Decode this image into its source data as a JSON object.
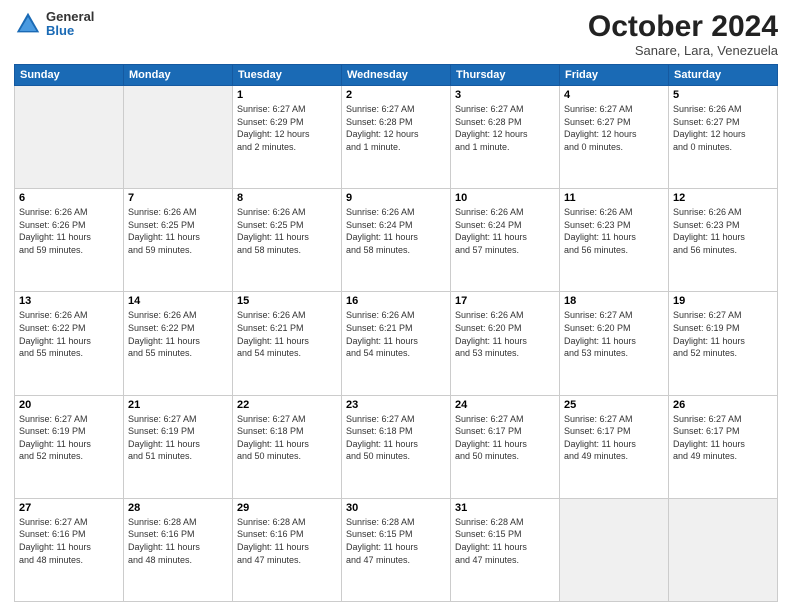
{
  "header": {
    "logo_line1": "General",
    "logo_line2": "Blue",
    "month": "October 2024",
    "location": "Sanare, Lara, Venezuela"
  },
  "weekdays": [
    "Sunday",
    "Monday",
    "Tuesday",
    "Wednesday",
    "Thursday",
    "Friday",
    "Saturday"
  ],
  "weeks": [
    [
      {
        "day": "",
        "info": ""
      },
      {
        "day": "",
        "info": ""
      },
      {
        "day": "1",
        "info": "Sunrise: 6:27 AM\nSunset: 6:29 PM\nDaylight: 12 hours\nand 2 minutes."
      },
      {
        "day": "2",
        "info": "Sunrise: 6:27 AM\nSunset: 6:28 PM\nDaylight: 12 hours\nand 1 minute."
      },
      {
        "day": "3",
        "info": "Sunrise: 6:27 AM\nSunset: 6:28 PM\nDaylight: 12 hours\nand 1 minute."
      },
      {
        "day": "4",
        "info": "Sunrise: 6:27 AM\nSunset: 6:27 PM\nDaylight: 12 hours\nand 0 minutes."
      },
      {
        "day": "5",
        "info": "Sunrise: 6:26 AM\nSunset: 6:27 PM\nDaylight: 12 hours\nand 0 minutes."
      }
    ],
    [
      {
        "day": "6",
        "info": "Sunrise: 6:26 AM\nSunset: 6:26 PM\nDaylight: 11 hours\nand 59 minutes."
      },
      {
        "day": "7",
        "info": "Sunrise: 6:26 AM\nSunset: 6:25 PM\nDaylight: 11 hours\nand 59 minutes."
      },
      {
        "day": "8",
        "info": "Sunrise: 6:26 AM\nSunset: 6:25 PM\nDaylight: 11 hours\nand 58 minutes."
      },
      {
        "day": "9",
        "info": "Sunrise: 6:26 AM\nSunset: 6:24 PM\nDaylight: 11 hours\nand 58 minutes."
      },
      {
        "day": "10",
        "info": "Sunrise: 6:26 AM\nSunset: 6:24 PM\nDaylight: 11 hours\nand 57 minutes."
      },
      {
        "day": "11",
        "info": "Sunrise: 6:26 AM\nSunset: 6:23 PM\nDaylight: 11 hours\nand 56 minutes."
      },
      {
        "day": "12",
        "info": "Sunrise: 6:26 AM\nSunset: 6:23 PM\nDaylight: 11 hours\nand 56 minutes."
      }
    ],
    [
      {
        "day": "13",
        "info": "Sunrise: 6:26 AM\nSunset: 6:22 PM\nDaylight: 11 hours\nand 55 minutes."
      },
      {
        "day": "14",
        "info": "Sunrise: 6:26 AM\nSunset: 6:22 PM\nDaylight: 11 hours\nand 55 minutes."
      },
      {
        "day": "15",
        "info": "Sunrise: 6:26 AM\nSunset: 6:21 PM\nDaylight: 11 hours\nand 54 minutes."
      },
      {
        "day": "16",
        "info": "Sunrise: 6:26 AM\nSunset: 6:21 PM\nDaylight: 11 hours\nand 54 minutes."
      },
      {
        "day": "17",
        "info": "Sunrise: 6:26 AM\nSunset: 6:20 PM\nDaylight: 11 hours\nand 53 minutes."
      },
      {
        "day": "18",
        "info": "Sunrise: 6:27 AM\nSunset: 6:20 PM\nDaylight: 11 hours\nand 53 minutes."
      },
      {
        "day": "19",
        "info": "Sunrise: 6:27 AM\nSunset: 6:19 PM\nDaylight: 11 hours\nand 52 minutes."
      }
    ],
    [
      {
        "day": "20",
        "info": "Sunrise: 6:27 AM\nSunset: 6:19 PM\nDaylight: 11 hours\nand 52 minutes."
      },
      {
        "day": "21",
        "info": "Sunrise: 6:27 AM\nSunset: 6:19 PM\nDaylight: 11 hours\nand 51 minutes."
      },
      {
        "day": "22",
        "info": "Sunrise: 6:27 AM\nSunset: 6:18 PM\nDaylight: 11 hours\nand 50 minutes."
      },
      {
        "day": "23",
        "info": "Sunrise: 6:27 AM\nSunset: 6:18 PM\nDaylight: 11 hours\nand 50 minutes."
      },
      {
        "day": "24",
        "info": "Sunrise: 6:27 AM\nSunset: 6:17 PM\nDaylight: 11 hours\nand 50 minutes."
      },
      {
        "day": "25",
        "info": "Sunrise: 6:27 AM\nSunset: 6:17 PM\nDaylight: 11 hours\nand 49 minutes."
      },
      {
        "day": "26",
        "info": "Sunrise: 6:27 AM\nSunset: 6:17 PM\nDaylight: 11 hours\nand 49 minutes."
      }
    ],
    [
      {
        "day": "27",
        "info": "Sunrise: 6:27 AM\nSunset: 6:16 PM\nDaylight: 11 hours\nand 48 minutes."
      },
      {
        "day": "28",
        "info": "Sunrise: 6:28 AM\nSunset: 6:16 PM\nDaylight: 11 hours\nand 48 minutes."
      },
      {
        "day": "29",
        "info": "Sunrise: 6:28 AM\nSunset: 6:16 PM\nDaylight: 11 hours\nand 47 minutes."
      },
      {
        "day": "30",
        "info": "Sunrise: 6:28 AM\nSunset: 6:15 PM\nDaylight: 11 hours\nand 47 minutes."
      },
      {
        "day": "31",
        "info": "Sunrise: 6:28 AM\nSunset: 6:15 PM\nDaylight: 11 hours\nand 47 minutes."
      },
      {
        "day": "",
        "info": ""
      },
      {
        "day": "",
        "info": ""
      }
    ]
  ]
}
